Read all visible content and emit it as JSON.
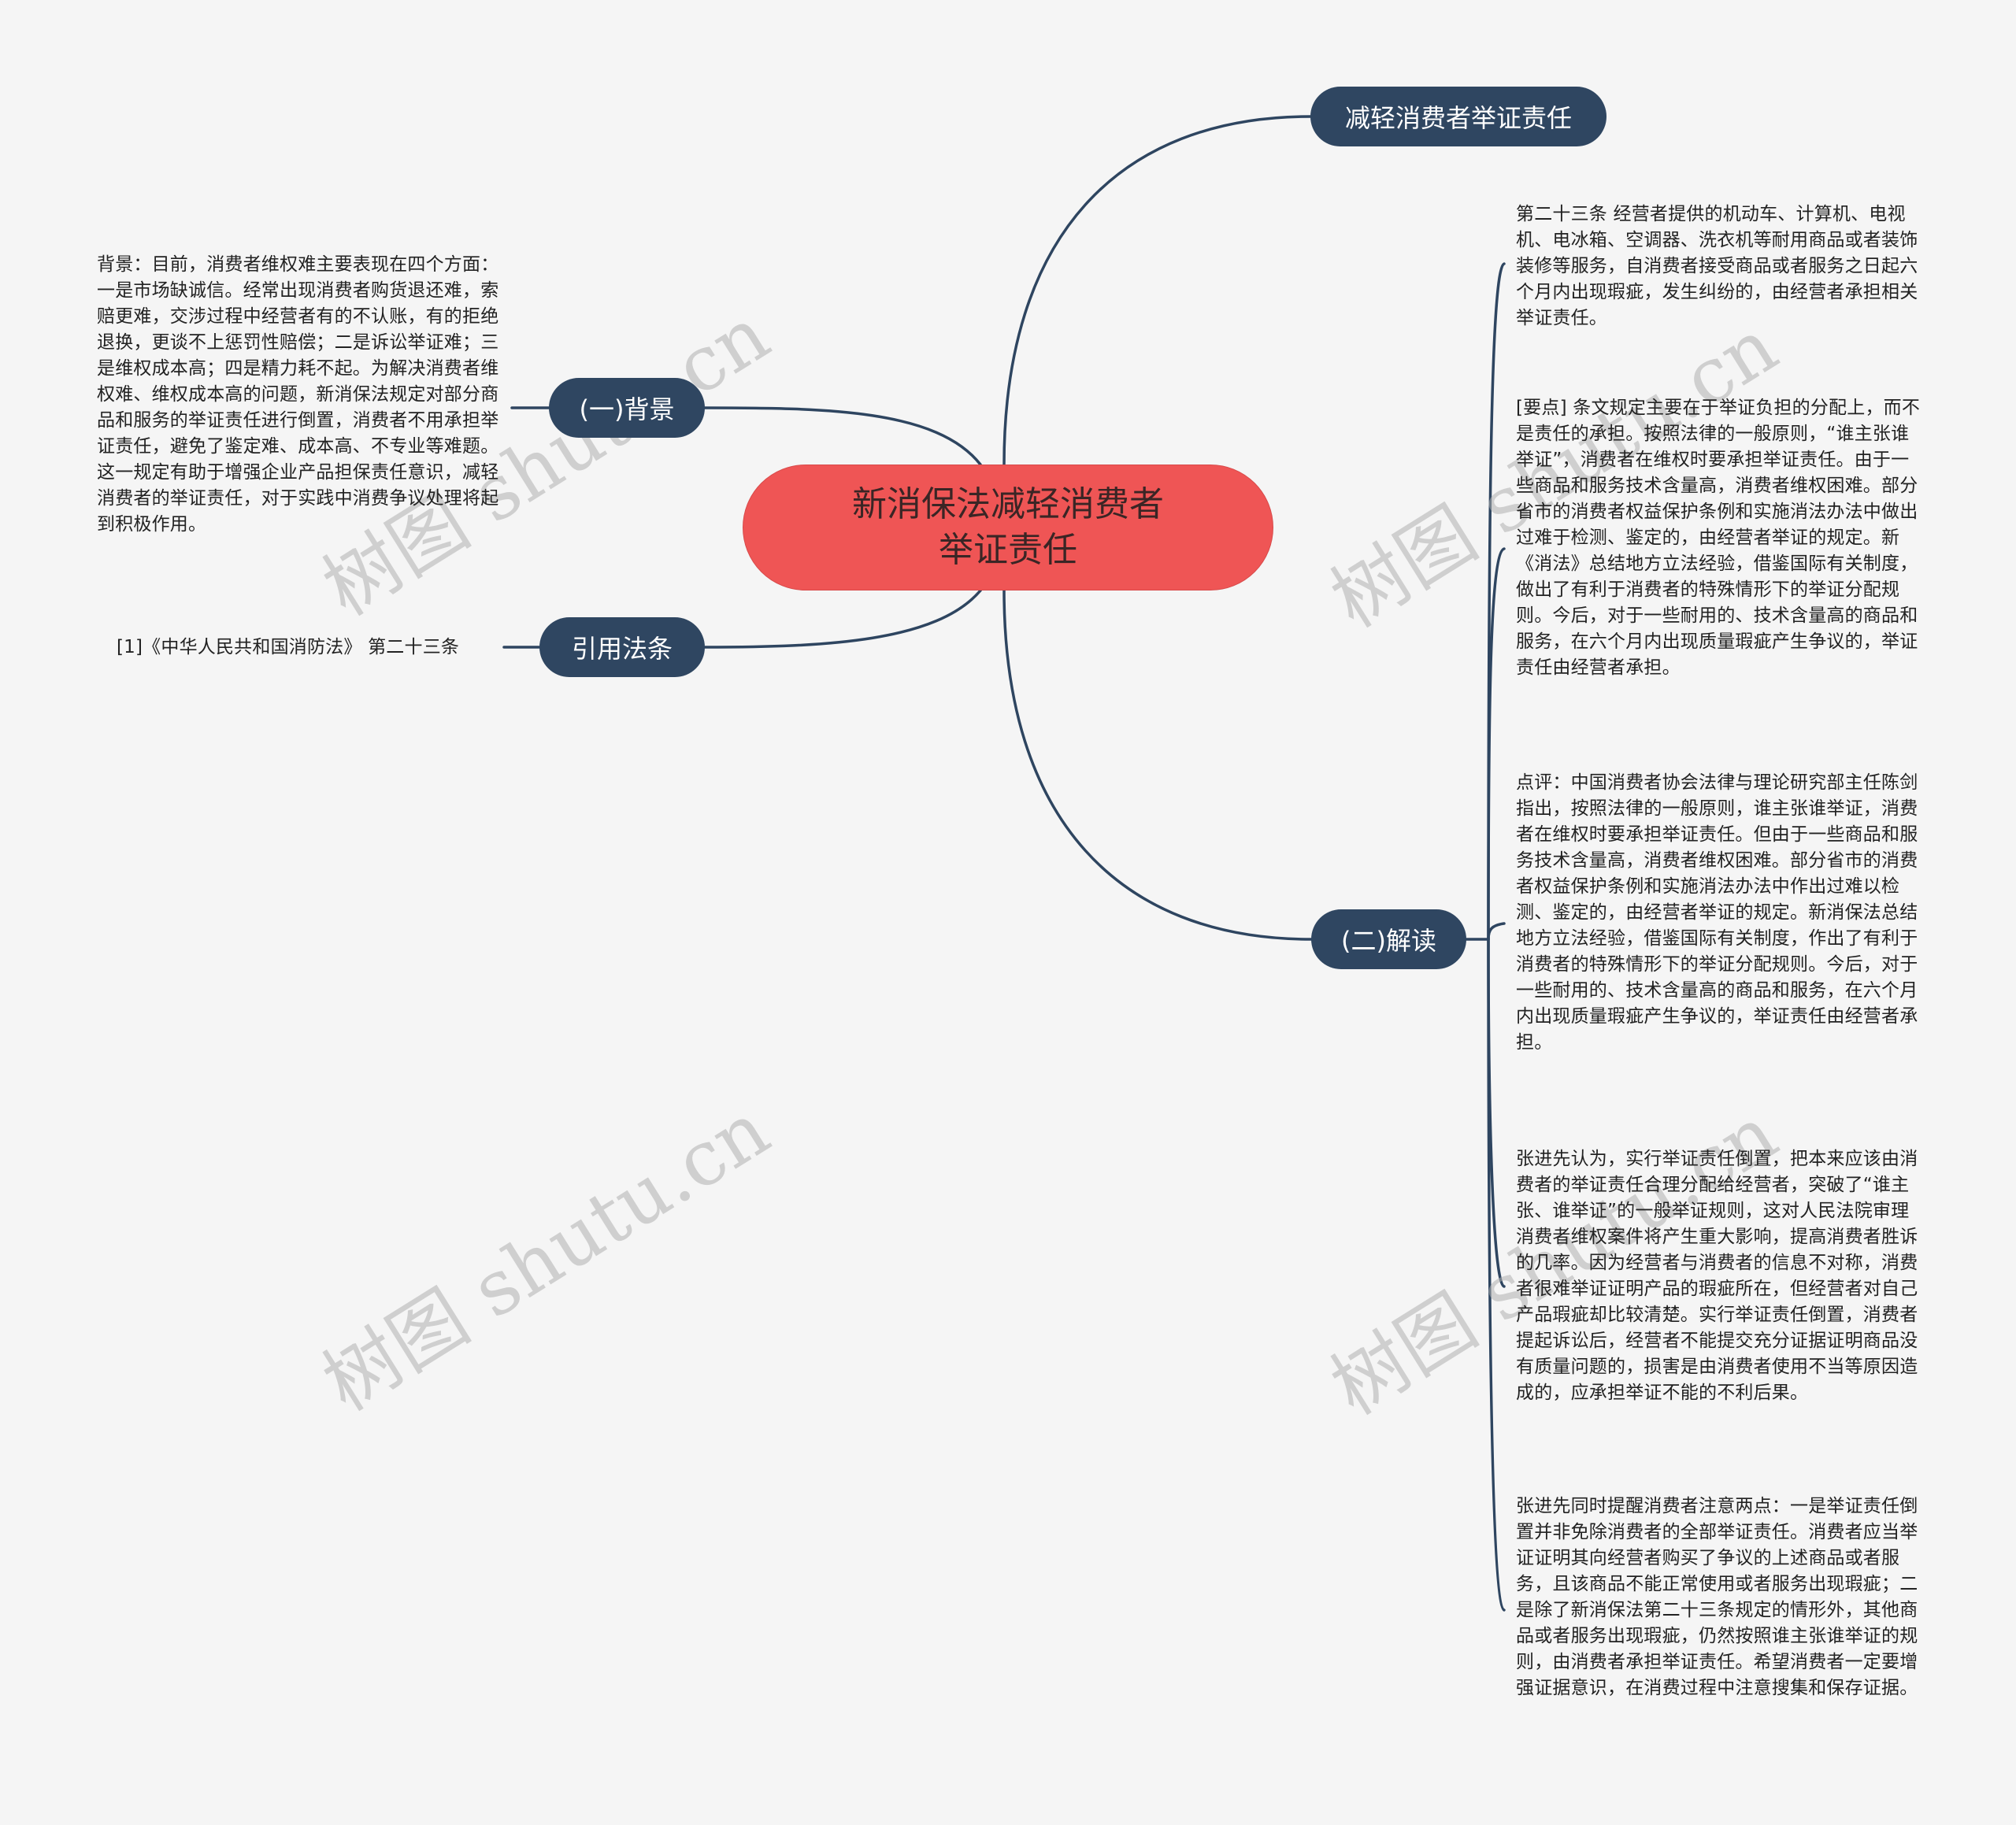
{
  "mindmap": {
    "root": {
      "label": "新消保法减轻消费者举证责任"
    },
    "branches": {
      "reduce": {
        "label": "减轻消费者举证责任"
      },
      "background": {
        "label": "(一)背景",
        "text": "背景：目前，消费者维权难主要表现在四个方面：一是市场缺诚信。经常出现消费者购货退还难，索赔更难，交涉过程中经营者有的不认账，有的拒绝退换，更谈不上惩罚性赔偿；二是诉讼举证难；三是维权成本高；四是精力耗不起。为解决消费者维权难、维权成本高的问题，新消保法规定对部分商品和服务的举证责任进行倒置，消费者不用承担举证责任，避免了鉴定难、成本高、不专业等难题。这一规定有助于增强企业产品担保责任意识，减轻消费者的举证责任，对于实践中消费争议处理将起到积极作用。"
      },
      "citation": {
        "label": "引用法条",
        "text": "[1]《中华人民共和国消防法》 第二十三条"
      },
      "interpretation": {
        "label": "(二)解读",
        "items": [
          {
            "text": "第二十三条 经营者提供的机动车、计算机、电视机、电冰箱、空调器、洗衣机等耐用商品或者装饰装修等服务，自消费者接受商品或者服务之日起六个月内出现瑕疵，发生纠纷的，由经营者承担相关举证责任。"
          },
          {
            "text": "[要点] 条文规定主要在于举证负担的分配上，而不是责任的承担。按照法律的一般原则，“谁主张谁举证”，消费者在维权时要承担举证责任。由于一些商品和服务技术含量高，消费者维权困难。部分省市的消费者权益保护条例和实施消法办法中做出过难于检测、鉴定的，由经营者举证的规定。新《消法》总结地方立法经验，借鉴国际有关制度，做出了有利于消费者的特殊情形下的举证分配规则。今后，对于一些耐用的、技术含量高的商品和服务，在六个月内出现质量瑕疵产生争议的，举证责任由经营者承担。"
          },
          {
            "text": "点评：中国消费者协会法律与理论研究部主任陈剑指出，按照法律的一般原则，谁主张谁举证，消费者在维权时要承担举证责任。但由于一些商品和服务技术含量高，消费者维权困难。部分省市的消费者权益保护条例和实施消法办法中作出过难以检测、鉴定的，由经营者举证的规定。新消保法总结地方立法经验，借鉴国际有关制度，作出了有利于消费者的特殊情形下的举证分配规则。今后，对于一些耐用的、技术含量高的商品和服务，在六个月内出现质量瑕疵产生争议的，举证责任由经营者承担。"
          },
          {
            "text": "张进先认为，实行举证责任倒置，把本来应该由消费者的举证责任合理分配给经营者，突破了“谁主张、谁举证”的一般举证规则，这对人民法院审理消费者维权案件将产生重大影响，提高消费者胜诉的几率。因为经营者与消费者的信息不对称，消费者很难举证证明产品的瑕疵所在，但经营者对自己产品瑕疵却比较清楚。实行举证责任倒置，消费者提起诉讼后，经营者不能提交充分证据证明商品没有质量问题的，损害是由消费者使用不当等原因造成的，应承担举证不能的不利后果。"
          },
          {
            "text": "张进先同时提醒消费者注意两点：一是举证责任倒置并非免除消费者的全部举证责任。消费者应当举证证明其向经营者购买了争议的上述商品或者服务，且该商品不能正常使用或者服务出现瑕疵；二是除了新消保法第二十三条规定的情形外，其他商品或者服务出现瑕疵，仍然按照谁主张谁举证的规则，由消费者承担举证责任。希望消费者一定要增强证据意识，在消费过程中注意搜集和保存证据。"
          }
        ]
      }
    }
  },
  "watermark": {
    "text": "树图 shutu.cn"
  },
  "colors": {
    "root_fill": "#ef5555",
    "node_fill": "#2f4661",
    "connector": "#2e4560",
    "background": "#f5f5f5"
  }
}
